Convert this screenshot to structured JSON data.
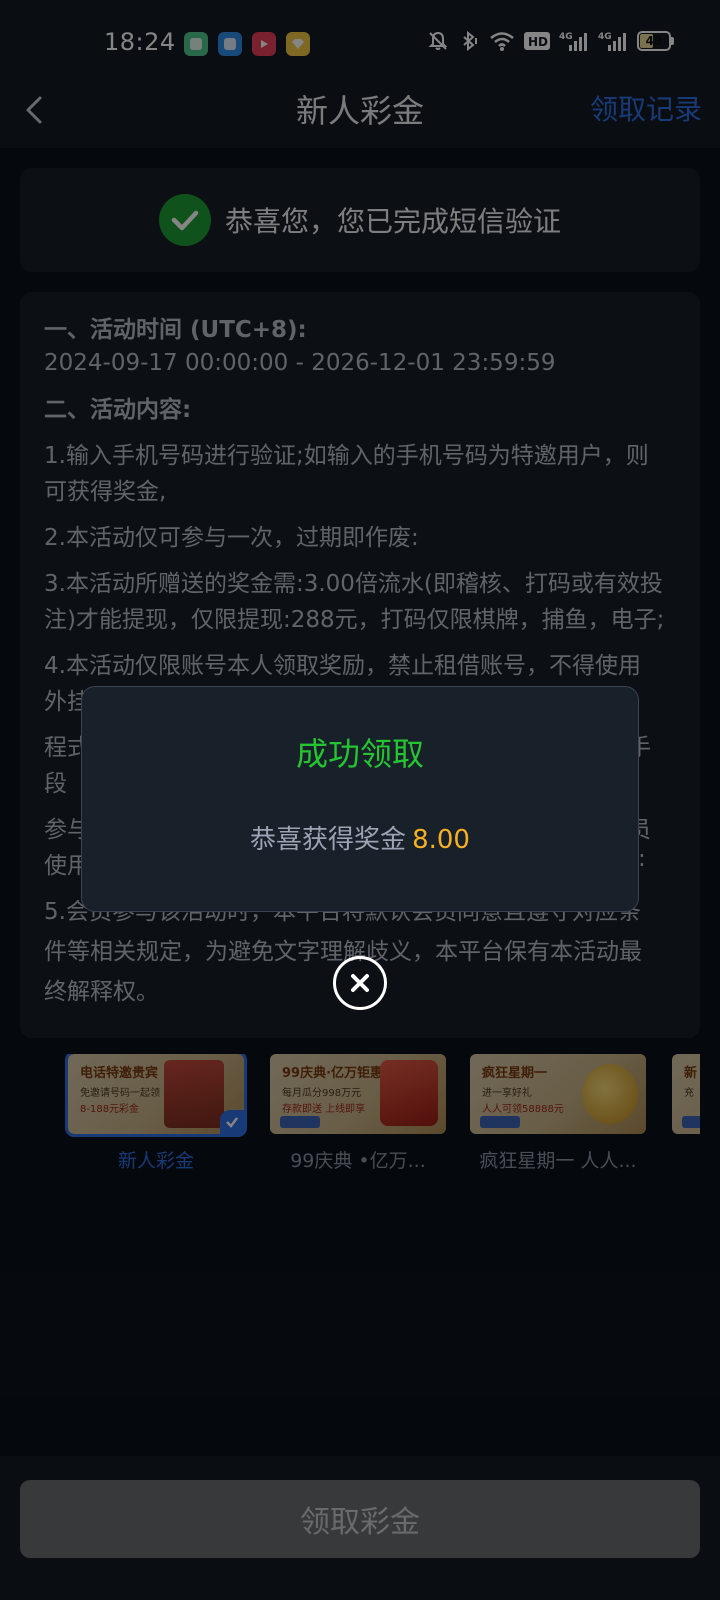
{
  "status_bar": {
    "time": "18:24",
    "app_icons": [
      {
        "name": "app-notification-green",
        "color": "#4fc98f"
      },
      {
        "name": "app-notification-blue",
        "color": "#2f8fe8"
      },
      {
        "name": "app-notification-red",
        "color": "#e8405a"
      },
      {
        "name": "app-notification-yellow",
        "color": "#f2c744"
      }
    ],
    "network_hd": "HD",
    "network_4g_1": "4G",
    "network_4g_2": "4G",
    "battery_level": "49",
    "battery_fraction": 0.49
  },
  "header": {
    "title": "新人彩金",
    "history_link": "领取记录"
  },
  "verify_card": {
    "message": "恭喜您，您已完成短信验证"
  },
  "rules": {
    "line1": "一、活动时间 (UTC+8):",
    "line2": "2024-09-17 00:00:00 - 2026-12-01 23:59:59",
    "line3": "二、活动内容:",
    "line4": "1.输入手机号码进行验证;如输入的手机号码为特邀用户，则",
    "line5": "可获得奖金,",
    "line6": "2.本活动仅可参与一次，过期即作废:",
    "line7": "3.本活动所赠送的奖金需:3.00倍流水(即稽核、打码或有效投",
    "line8": "注)才能提现，仅限提现:288元，打码仅限棋牌，捕鱼，电子;",
    "line9": "4.本活动仅限账号本人领取奖励，禁止租借账号，不得使用",
    "line10": "外挂",
    "line11": "程式",
    "line11_end": "手",
    "line12": "段",
    "line13": "参与",
    "line13_end": "员",
    "line14": "使用",
    "line14_end": ":",
    "line15": "5.会员参与该活动时，本平台将默认会员同意且遵守对应条",
    "line16": "件等相关规定，为避免文字理解歧义，本平台保有本活动最",
    "line17": "终解释权。"
  },
  "modal": {
    "title": "成功领取",
    "message": "恭喜获得奖金",
    "amount": "8.00"
  },
  "promos": [
    {
      "label": "新人彩金",
      "head": "电话特邀贵宾",
      "sub": "免邀请号码一起领",
      "sub2": "8-188元彩金",
      "selected": true
    },
    {
      "label": "99庆典 •亿万...",
      "head": "99庆典·亿万钜惠",
      "sub": "每月瓜分998万元",
      "sub2": "存款即送 上线即享",
      "selected": false
    },
    {
      "label": "疯狂星期一 人人...",
      "head": "疯狂星期一",
      "sub": "进一享好礼",
      "sub2": "人人可领58888元",
      "selected": false
    },
    {
      "label": "",
      "head": "新",
      "sub": "充",
      "sub2": "",
      "selected": false
    }
  ],
  "bottom": {
    "claim_button": "领取彩金"
  },
  "colors": {
    "accent_blue": "#2f6fe4",
    "success_green": "#25c431",
    "amount_orange": "#f6b023",
    "disabled_button": "#6b6d70"
  }
}
